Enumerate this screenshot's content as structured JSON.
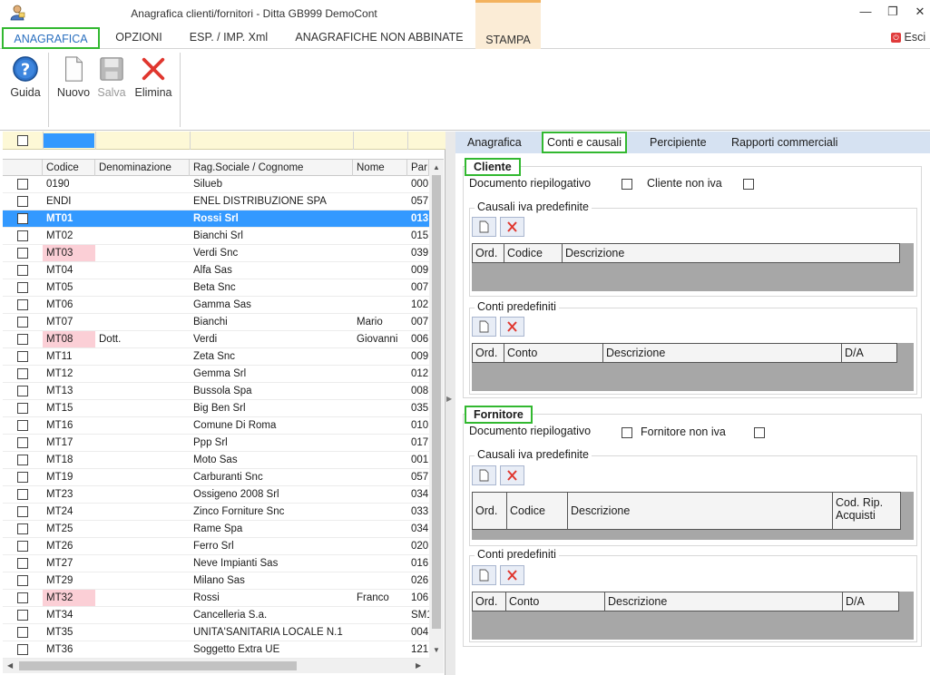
{
  "window": {
    "title": "Anagrafica clienti/fornitori - Ditta GB999 DemoCont",
    "minimize": "—",
    "restore": "❐",
    "close": "✕"
  },
  "menu": {
    "items": [
      "ANAGRAFICA",
      "OPZIONI",
      "ESP. / IMP. Xml",
      "ANAGRAFICHE NON ABBINATE",
      "STAMPA"
    ],
    "exit_label": "Esci"
  },
  "ribbon": {
    "guida": "Guida",
    "nuovo": "Nuovo",
    "salva": "Salva",
    "elimina": "Elimina"
  },
  "grid": {
    "columns": [
      "Codice",
      "Denominazione",
      "Rag.Sociale / Cognome",
      "Nome",
      "Par"
    ],
    "rows": [
      {
        "codice": "0190",
        "denominazione": "",
        "rag": "Silueb",
        "nome": "",
        "par": "000",
        "pink": false,
        "selected": false
      },
      {
        "codice": "ENDI",
        "denominazione": "",
        "rag": "ENEL DISTRIBUZIONE SPA",
        "nome": "",
        "par": "057",
        "pink": false,
        "selected": false
      },
      {
        "codice": "MT01",
        "denominazione": "",
        "rag": "Rossi Srl",
        "nome": "",
        "par": "013",
        "pink": false,
        "selected": true
      },
      {
        "codice": "MT02",
        "denominazione": "",
        "rag": "Bianchi Srl",
        "nome": "",
        "par": "015",
        "pink": false,
        "selected": false
      },
      {
        "codice": "MT03",
        "denominazione": "",
        "rag": "Verdi Snc",
        "nome": "",
        "par": "039",
        "pink": true,
        "selected": false
      },
      {
        "codice": "MT04",
        "denominazione": "",
        "rag": "Alfa Sas",
        "nome": "",
        "par": "009",
        "pink": false,
        "selected": false
      },
      {
        "codice": "MT05",
        "denominazione": "",
        "rag": "Beta Snc",
        "nome": "",
        "par": "007",
        "pink": false,
        "selected": false
      },
      {
        "codice": "MT06",
        "denominazione": "",
        "rag": "Gamma Sas",
        "nome": "",
        "par": "102",
        "pink": false,
        "selected": false
      },
      {
        "codice": "MT07",
        "denominazione": "",
        "rag": "Bianchi",
        "nome": "Mario",
        "par": "007",
        "pink": false,
        "selected": false
      },
      {
        "codice": "MT08",
        "denominazione": "Dott.",
        "rag": "Verdi",
        "nome": "Giovanni",
        "par": "006",
        "pink": true,
        "selected": false
      },
      {
        "codice": "MT11",
        "denominazione": "",
        "rag": "Zeta Snc",
        "nome": "",
        "par": "009",
        "pink": false,
        "selected": false
      },
      {
        "codice": "MT12",
        "denominazione": "",
        "rag": "Gemma Srl",
        "nome": "",
        "par": "012",
        "pink": false,
        "selected": false
      },
      {
        "codice": "MT13",
        "denominazione": "",
        "rag": "Bussola Spa",
        "nome": "",
        "par": "008",
        "pink": false,
        "selected": false
      },
      {
        "codice": "MT15",
        "denominazione": "",
        "rag": "Big Ben Srl",
        "nome": "",
        "par": "035",
        "pink": false,
        "selected": false
      },
      {
        "codice": "MT16",
        "denominazione": "",
        "rag": "Comune Di Roma",
        "nome": "",
        "par": "010",
        "pink": false,
        "selected": false
      },
      {
        "codice": "MT17",
        "denominazione": "",
        "rag": "Ppp Srl",
        "nome": "",
        "par": "017",
        "pink": false,
        "selected": false
      },
      {
        "codice": "MT18",
        "denominazione": "",
        "rag": "Moto Sas",
        "nome": "",
        "par": "001",
        "pink": false,
        "selected": false
      },
      {
        "codice": "MT19",
        "denominazione": "",
        "rag": "Carburanti Snc",
        "nome": "",
        "par": "057",
        "pink": false,
        "selected": false
      },
      {
        "codice": "MT23",
        "denominazione": "",
        "rag": "Ossigeno 2008 Srl",
        "nome": "",
        "par": "034",
        "pink": false,
        "selected": false
      },
      {
        "codice": "MT24",
        "denominazione": "",
        "rag": "Zinco Forniture Snc",
        "nome": "",
        "par": "033",
        "pink": false,
        "selected": false
      },
      {
        "codice": "MT25",
        "denominazione": "",
        "rag": "Rame Spa",
        "nome": "",
        "par": "034",
        "pink": false,
        "selected": false
      },
      {
        "codice": "MT26",
        "denominazione": "",
        "rag": "Ferro Srl",
        "nome": "",
        "par": "020",
        "pink": false,
        "selected": false
      },
      {
        "codice": "MT27",
        "denominazione": "",
        "rag": "Neve Impianti Sas",
        "nome": "",
        "par": "016",
        "pink": false,
        "selected": false
      },
      {
        "codice": "MT29",
        "denominazione": "",
        "rag": "Milano Sas",
        "nome": "",
        "par": "026",
        "pink": false,
        "selected": false
      },
      {
        "codice": "MT32",
        "denominazione": "",
        "rag": "Rossi",
        "nome": "Franco",
        "par": "106",
        "pink": true,
        "selected": false
      },
      {
        "codice": "MT34",
        "denominazione": "",
        "rag": "Cancelleria S.a.",
        "nome": "",
        "par": "SM1",
        "pink": false,
        "selected": false
      },
      {
        "codice": "MT35",
        "denominazione": "",
        "rag": "UNITA'SANITARIA LOCALE N.1",
        "nome": "",
        "par": "004",
        "pink": false,
        "selected": false
      },
      {
        "codice": "MT36",
        "denominazione": "",
        "rag": "Soggetto Extra UE",
        "nome": "",
        "par": "121",
        "pink": false,
        "selected": false
      }
    ]
  },
  "tabs": [
    "Anagrafica",
    "Conti e causali",
    "Percipiente",
    "Rapporti commerciali"
  ],
  "cliente": {
    "title": "Cliente",
    "doc_riepilogativo": "Documento riepilogativo",
    "non_iva": "Cliente non iva",
    "causali_title": "Causali iva predefinite",
    "causali_cols": [
      "Ord.",
      "Codice",
      "Descrizione"
    ],
    "conti_title": "Conti predefiniti",
    "conti_cols": [
      "Ord.",
      "Conto",
      "Descrizione",
      "D/A"
    ]
  },
  "fornitore": {
    "title": "Fornitore",
    "doc_riepilogativo": "Documento riepilogativo",
    "non_iva": "Fornitore non iva",
    "causali_title": "Causali iva predefinite",
    "causali_cols": [
      "Ord.",
      "Codice",
      "Descrizione",
      "Cod. Rip. Acquisti"
    ],
    "conti_title": "Conti predefiniti",
    "conti_cols": [
      "Ord.",
      "Conto",
      "Descrizione",
      "D/A"
    ]
  },
  "colors": {
    "highlight_green": "#32b830",
    "selected_row": "#3399ff",
    "pink_code": "#fbcfd6",
    "tab_bar": "#d6e2f2",
    "stampa_tab": "#fbecd6"
  }
}
